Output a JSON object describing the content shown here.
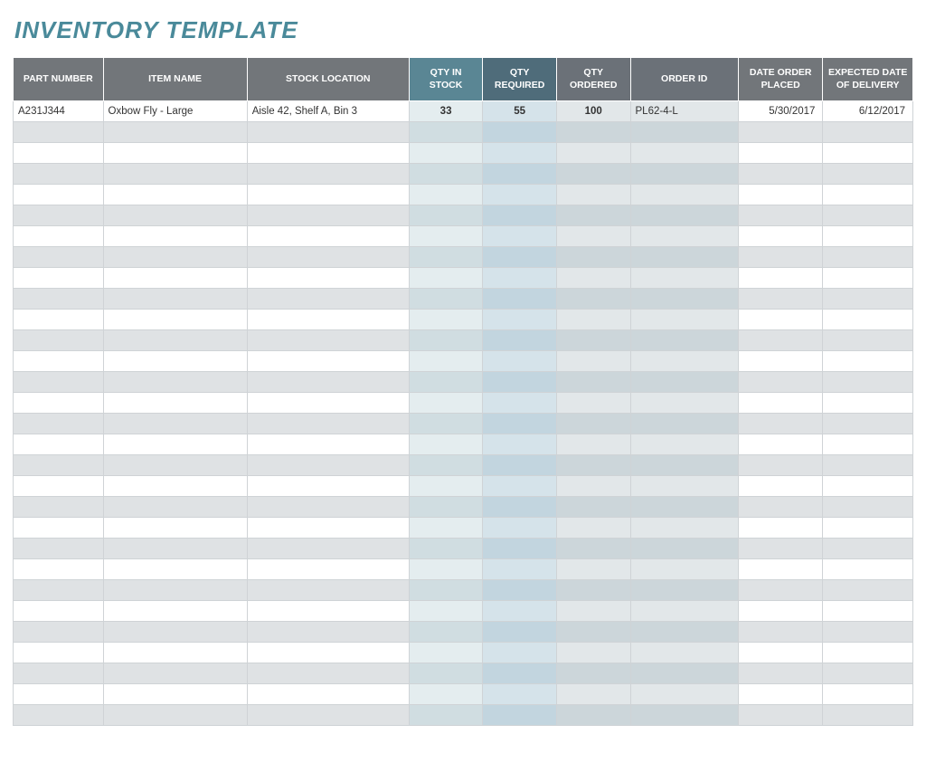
{
  "title": "INVENTORY TEMPLATE",
  "headers": {
    "part_number": "PART NUMBER",
    "item_name": "ITEM NAME",
    "stock_location": "STOCK LOCATION",
    "qty_in_stock": "QTY IN STOCK",
    "qty_required": "QTY REQUIRED",
    "qty_ordered": "QTY ORDERED",
    "order_id": "ORDER ID",
    "date_order_placed": "DATE ORDER PLACED",
    "expected_date_of_delivery": "EXPECTED DATE OF DELIVERY"
  },
  "rows": [
    {
      "part_number": "A231J344",
      "item_name": "Oxbow Fly - Large",
      "stock_location": "Aisle 42, Shelf A, Bin 3",
      "qty_in_stock": "33",
      "qty_required": "55",
      "qty_ordered": "100",
      "order_id": "PL62-4-L",
      "date_order_placed": "5/30/2017",
      "expected_date_of_delivery": "6/12/2017"
    }
  ],
  "empty_row_count": 29
}
